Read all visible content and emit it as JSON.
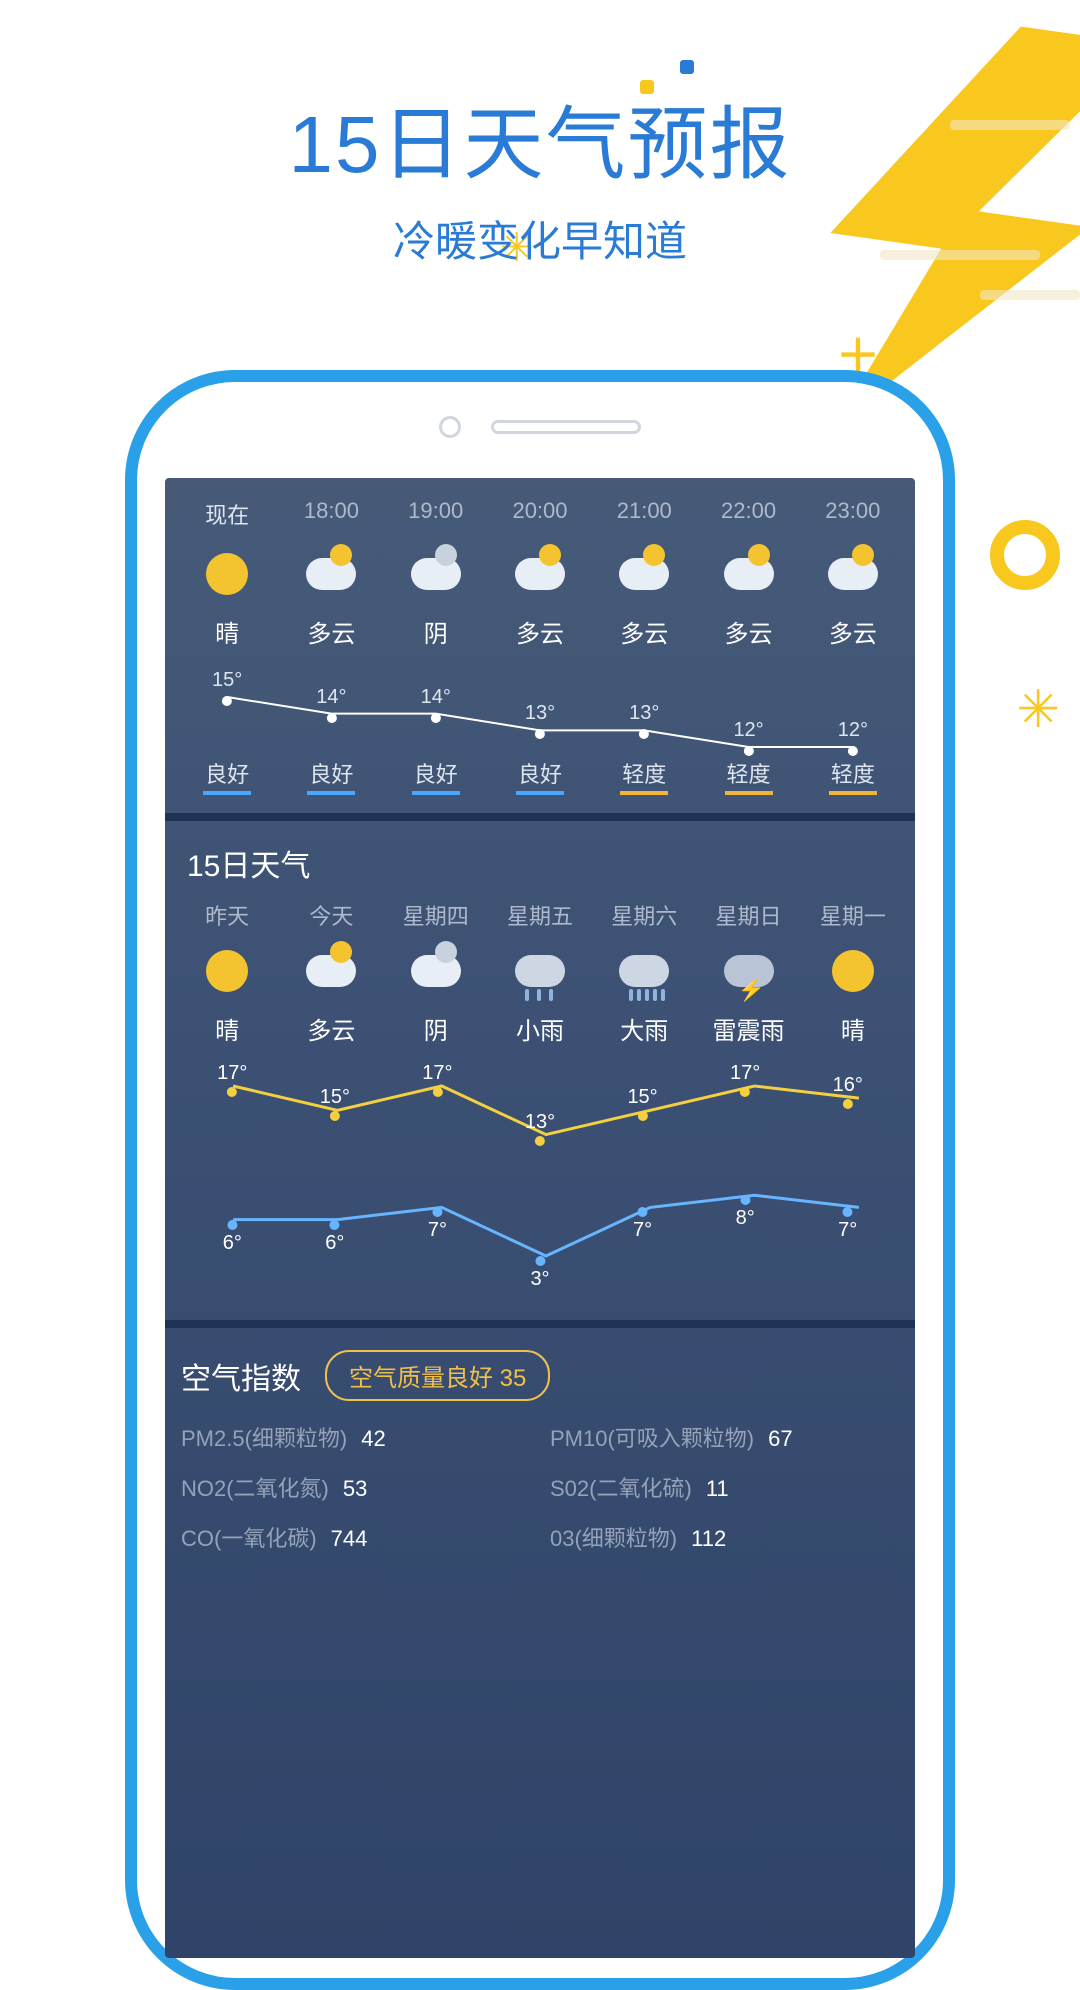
{
  "hero": {
    "title": "15日天气预报",
    "subtitle": "冷暖变化早知道"
  },
  "hourly": {
    "cells": [
      {
        "time": "现在",
        "icon": "sun",
        "cond": "晴",
        "temp": 15,
        "aqi": "良好",
        "aqi_level": "ok"
      },
      {
        "time": "18:00",
        "icon": "cloud",
        "cond": "多云",
        "temp": 14,
        "aqi": "良好",
        "aqi_level": "ok"
      },
      {
        "time": "19:00",
        "icon": "cloud-grey",
        "cond": "阴",
        "temp": 14,
        "aqi": "良好",
        "aqi_level": "ok"
      },
      {
        "time": "20:00",
        "icon": "cloud",
        "cond": "多云",
        "temp": 13,
        "aqi": "良好",
        "aqi_level": "ok"
      },
      {
        "time": "21:00",
        "icon": "cloud",
        "cond": "多云",
        "temp": 13,
        "aqi": "轻度",
        "aqi_level": "warn"
      },
      {
        "time": "22:00",
        "icon": "cloud",
        "cond": "多云",
        "temp": 12,
        "aqi": "轻度",
        "aqi_level": "warn"
      },
      {
        "time": "23:00",
        "icon": "cloud",
        "cond": "多云",
        "temp": 12,
        "aqi": "轻度",
        "aqi_level": "warn"
      }
    ]
  },
  "daily": {
    "title": "15日天气",
    "cells": [
      {
        "day": "昨天",
        "icon": "sun",
        "cond": "晴",
        "hi": 17,
        "lo": 6
      },
      {
        "day": "今天",
        "icon": "cloud",
        "cond": "多云",
        "hi": 15,
        "lo": 6
      },
      {
        "day": "星期四",
        "icon": "cloud-grey",
        "cond": "阴",
        "hi": 17,
        "lo": 7
      },
      {
        "day": "星期五",
        "icon": "rain",
        "cond": "小雨",
        "hi": 13,
        "lo": 3
      },
      {
        "day": "星期六",
        "icon": "rain-heavy",
        "cond": "大雨",
        "hi": 15,
        "lo": 7
      },
      {
        "day": "星期日",
        "icon": "storm",
        "cond": "雷震雨",
        "hi": 17,
        "lo": 8
      },
      {
        "day": "星期一",
        "icon": "sun",
        "cond": "晴",
        "hi": 16,
        "lo": 7
      }
    ]
  },
  "air": {
    "title": "空气指数",
    "badge": "空气质量良好 35",
    "items": [
      {
        "label": "PM2.5(细颗粒物)",
        "value": "42"
      },
      {
        "label": "PM10(可吸入颗粒物)",
        "value": "67"
      },
      {
        "label": "NO2(二氧化氮)",
        "value": "53"
      },
      {
        "label": "S02(二氧化硫)",
        "value": "11"
      },
      {
        "label": "CO(一氧化碳)",
        "value": "744"
      },
      {
        "label": "03(细颗粒物)",
        "value": "112"
      }
    ]
  },
  "chart_data": {
    "type": "line",
    "hourly_temperature": {
      "x": [
        "现在",
        "18:00",
        "19:00",
        "20:00",
        "21:00",
        "22:00",
        "23:00"
      ],
      "y": [
        15,
        14,
        14,
        13,
        13,
        12,
        12
      ],
      "unit": "°"
    },
    "daily_high_low": {
      "x": [
        "昨天",
        "今天",
        "星期四",
        "星期五",
        "星期六",
        "星期日",
        "星期一"
      ],
      "series": [
        {
          "name": "high",
          "values": [
            17,
            15,
            17,
            13,
            15,
            17,
            16
          ],
          "color": "#f4d041"
        },
        {
          "name": "low",
          "values": [
            6,
            6,
            7,
            3,
            7,
            8,
            7
          ],
          "color": "#67b5ff"
        }
      ],
      "unit": "°"
    }
  }
}
